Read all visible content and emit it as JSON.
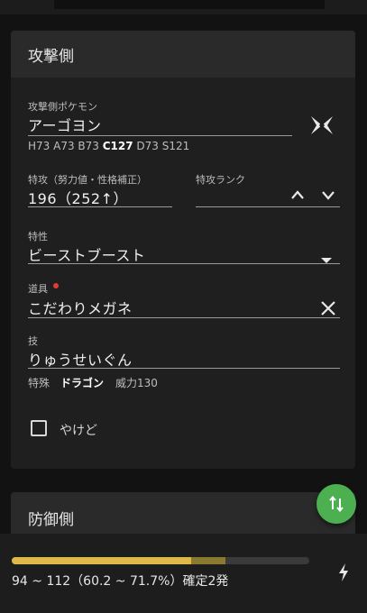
{
  "attacker": {
    "title": "攻撃側",
    "pokemon": {
      "label": "攻撃側ポケモン",
      "value": "アーゴヨン",
      "stats_prefix": "H73 A73 B73 ",
      "stats_bold": "C127",
      "stats_suffix": " D73 S121"
    },
    "spatk": {
      "label": "特攻（努力値・性格補正）",
      "value": "196（252↑）"
    },
    "rank": {
      "label": "特攻ランク",
      "value": ""
    },
    "ability": {
      "label": "特性",
      "value": "ビーストブースト"
    },
    "item": {
      "label": "道具",
      "value": "こだわりメガネ",
      "indicator_color": "#e53935"
    },
    "move": {
      "label": "技",
      "value": "りゅうせいぐん",
      "category": "特殊",
      "type": "ドラゴン",
      "power": "威力130"
    },
    "burn": {
      "label": "やけど",
      "checked": false
    }
  },
  "defender": {
    "title": "防御側"
  },
  "result": {
    "text": "94 ~ 112（60.2 ~ 71.7%）確定2発",
    "min_fraction": 0.602,
    "max_fraction": 0.717,
    "colors": {
      "min": "#e0b84a",
      "range": "#8a7a30",
      "track": "#3a3a3a"
    }
  },
  "icons": {
    "fab": "swap-vertical-icon",
    "bottom": "lightning-bolt-icon",
    "pokemon": "ultra-beast-icon"
  },
  "colors": {
    "fab": "#4caf50",
    "background": "#121212",
    "card": "#1f1f1f"
  }
}
